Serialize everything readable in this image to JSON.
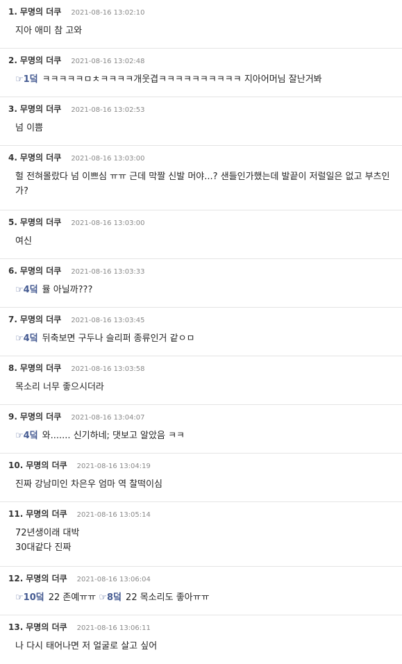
{
  "comments": [
    {
      "num": "1.",
      "author": "무명의 더쿠",
      "time": "2021-08-16 13:02:10",
      "segments": [
        {
          "text": "지아 애미 참 고와"
        }
      ]
    },
    {
      "num": "2.",
      "author": "무명의 더쿠",
      "time": "2021-08-16 13:02:48",
      "segments": [
        {
          "ref": "1덬"
        },
        {
          "text": "ㅋㅋㅋㅋㅋㅁㅊㅋㅋㅋㅋ개웃겹ㅋㅋㅋㅋㅋㅋㅋㅋㅋㅋ 지아어머님 잘난거봐"
        }
      ]
    },
    {
      "num": "3.",
      "author": "무명의 더쿠",
      "time": "2021-08-16 13:02:53",
      "segments": [
        {
          "text": "넘 이쁨"
        }
      ]
    },
    {
      "num": "4.",
      "author": "무명의 더쿠",
      "time": "2021-08-16 13:03:00",
      "segments": [
        {
          "text": "헐 전혀몰랐다 넘 이쁘심 ㅠㅠ 근데 막짤 신발 머야...? 샌들인가했는데 발끝이 저럴일은 없고 부츠인가?"
        }
      ]
    },
    {
      "num": "5.",
      "author": "무명의 더쿠",
      "time": "2021-08-16 13:03:00",
      "segments": [
        {
          "text": "여신"
        }
      ]
    },
    {
      "num": "6.",
      "author": "무명의 더쿠",
      "time": "2021-08-16 13:03:33",
      "segments": [
        {
          "ref": "4덬"
        },
        {
          "text": "뮬 아닐까???"
        }
      ]
    },
    {
      "num": "7.",
      "author": "무명의 더쿠",
      "time": "2021-08-16 13:03:45",
      "segments": [
        {
          "ref": "4덬"
        },
        {
          "text": "뒤축보면 구두나 슬리퍼 종류인거 같ㅇㅁ"
        }
      ]
    },
    {
      "num": "8.",
      "author": "무명의 더쿠",
      "time": "2021-08-16 13:03:58",
      "segments": [
        {
          "text": "목소리 너무 좋으시더라"
        }
      ]
    },
    {
      "num": "9.",
      "author": "무명의 더쿠",
      "time": "2021-08-16 13:04:07",
      "segments": [
        {
          "ref": "4덬"
        },
        {
          "text": "와....... 신기하네; 댓보고 알았음 ㅋㅋ"
        }
      ]
    },
    {
      "num": "10.",
      "author": "무명의 더쿠",
      "time": "2021-08-16 13:04:19",
      "segments": [
        {
          "text": "진짜 강남미인 차은우 엄마 역 찰떡이심"
        }
      ]
    },
    {
      "num": "11.",
      "author": "무명의 더쿠",
      "time": "2021-08-16 13:05:14",
      "segments": [
        {
          "text": "72년생이래 대박\n30대같다 진짜"
        }
      ]
    },
    {
      "num": "12.",
      "author": "무명의 더쿠",
      "time": "2021-08-16 13:06:04",
      "segments": [
        {
          "ref": "10덬"
        },
        {
          "text": "22 존예ㅠㅠ "
        },
        {
          "ref": "8덬"
        },
        {
          "text": "22 목소리도 좋아ㅠㅠ"
        }
      ]
    },
    {
      "num": "13.",
      "author": "무명의 더쿠",
      "time": "2021-08-16 13:06:11",
      "segments": [
        {
          "text": "나 다시 태어나면 저 얼굴로 살고 싶어"
        }
      ]
    }
  ],
  "icons": {
    "reply_ref": "pointing-hand-icon",
    "glyph": "☞"
  },
  "colors": {
    "reply_ref": "#445a91",
    "author": "#333333",
    "timestamp": "#888888",
    "divider": "#e4e4e4"
  }
}
